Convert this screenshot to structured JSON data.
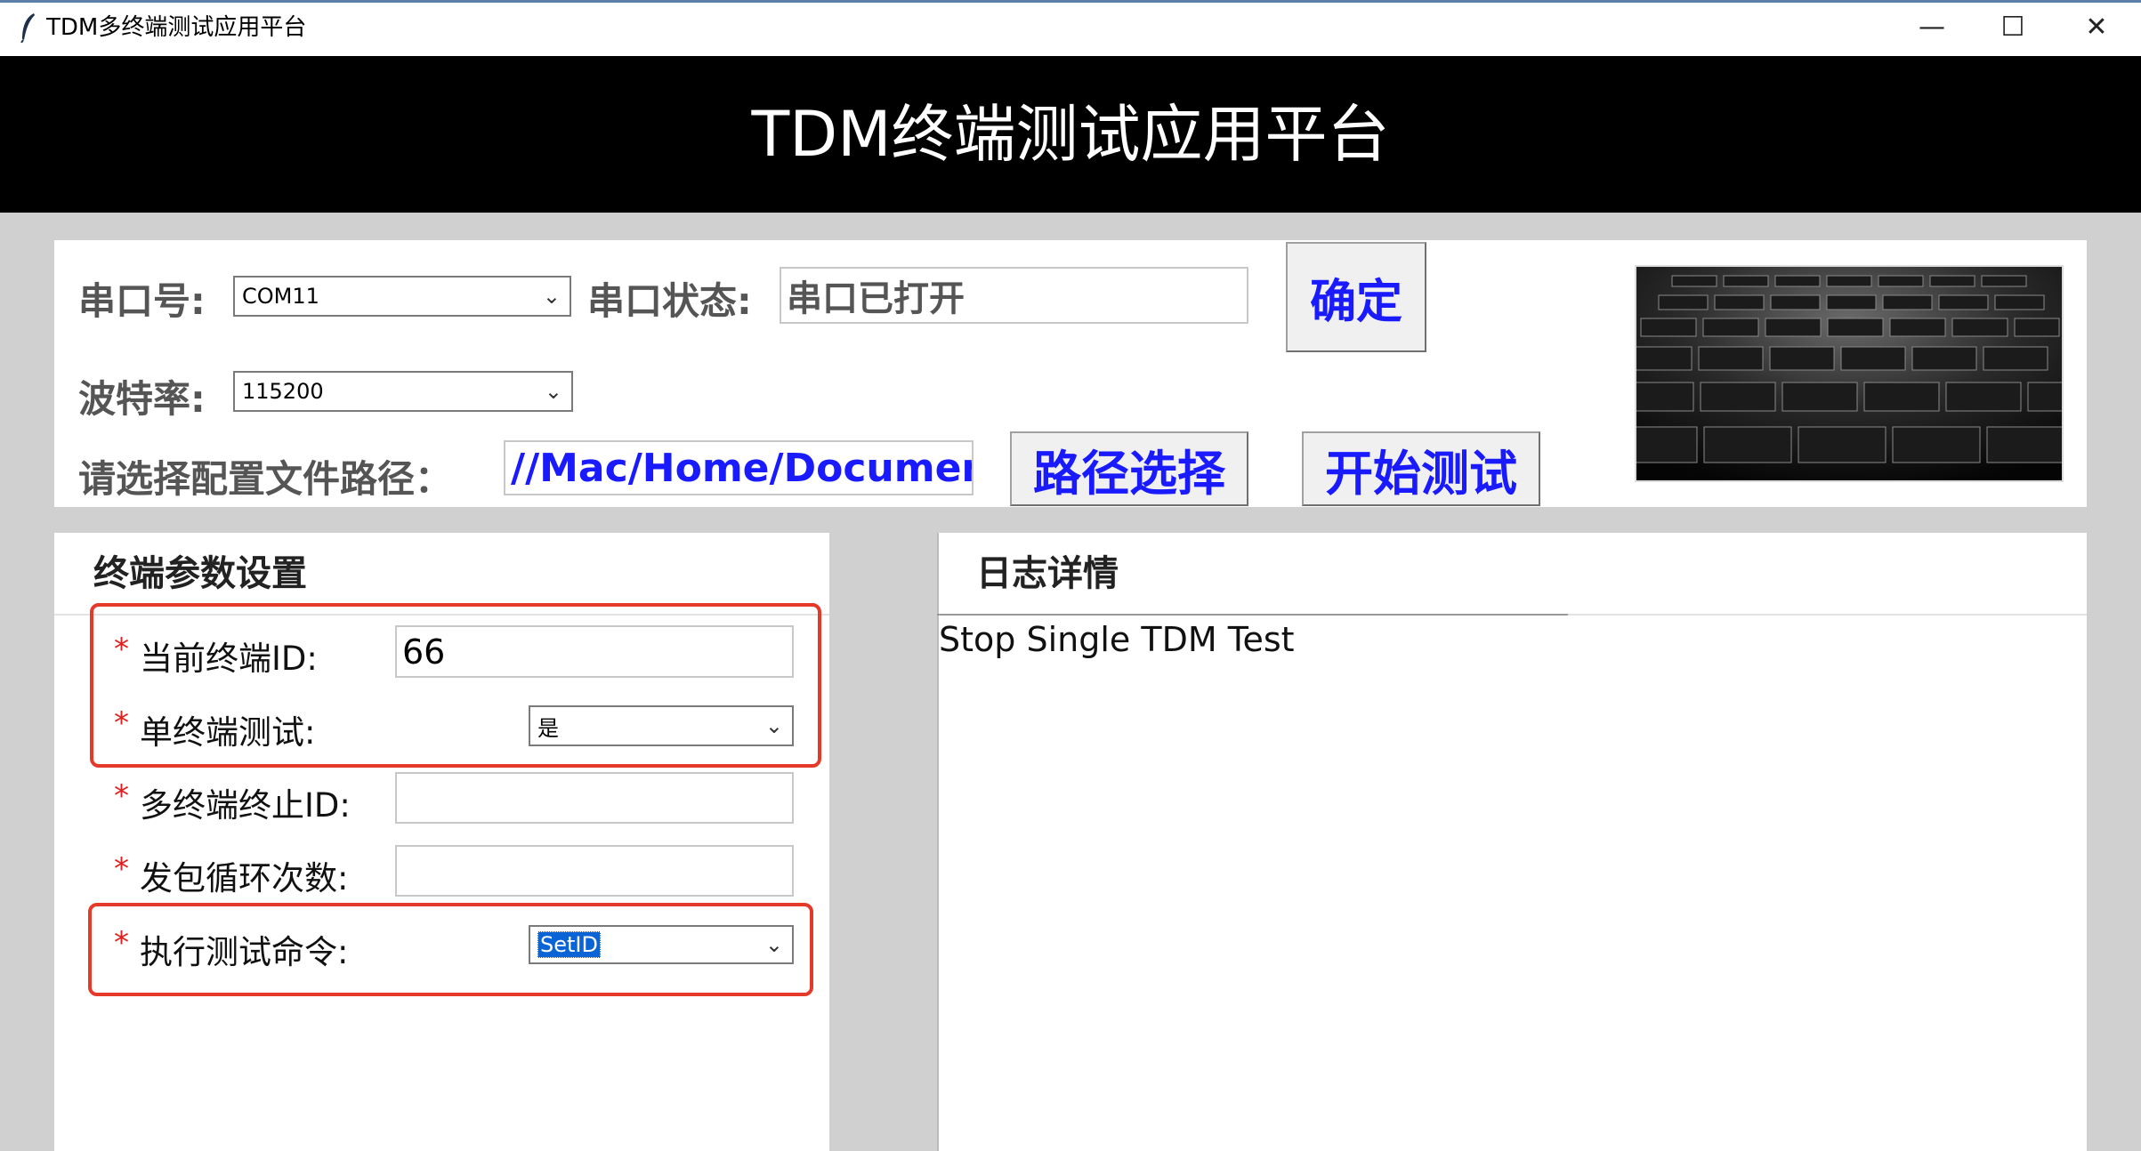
{
  "window": {
    "title": "TDM多终端测试应用平台",
    "minimize_glyph": "—",
    "maximize_glyph": "☐",
    "close_glyph": "✕"
  },
  "header": {
    "title": "TDM终端测试应用平台"
  },
  "config": {
    "port_label": "串口号:",
    "port_value": "COM11",
    "port_status_label": "串口状态:",
    "port_status_value": "串口已打开",
    "confirm_button": "确定",
    "baud_label": "波特率:",
    "baud_value": "115200",
    "path_label": "请选择配置文件路径：",
    "path_value": "//Mac/Home/Document",
    "path_button": "路径选择",
    "start_button": "开始测试"
  },
  "params": {
    "title": "终端参数设置",
    "required_mark": "*",
    "current_id_label": "当前终端ID:",
    "current_id_value": "66",
    "single_test_label": "单终端测试:",
    "single_test_value": "是",
    "multi_stop_id_label": "多终端终止ID:",
    "multi_stop_id_value": "",
    "loop_count_label": "发包循环次数:",
    "loop_count_value": "",
    "command_label": "执行测试命令:",
    "command_value": "SetID"
  },
  "log": {
    "title": "日志详情",
    "text": "Stop Single TDM Test"
  },
  "colors": {
    "header_bg": "#000000",
    "button_text": "#1a1aff",
    "highlight_box": "#e53a2a",
    "path_text": "#1a1aff"
  }
}
